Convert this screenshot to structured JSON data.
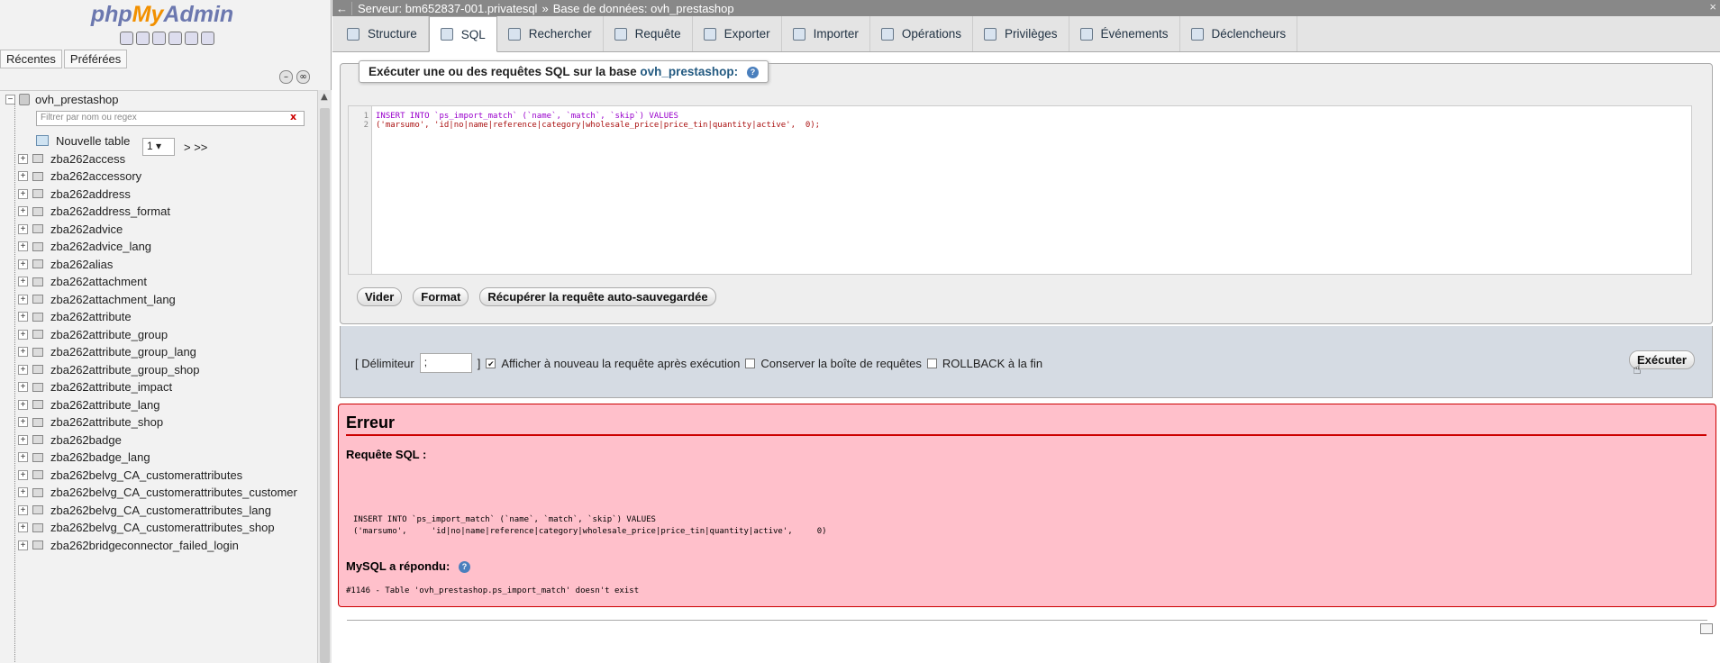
{
  "app": {
    "logo_php": "php",
    "logo_my": "My",
    "logo_admin": "Admin"
  },
  "nav": {
    "recent_tab": "Récentes",
    "favorites_tab": "Préférées",
    "database": "ovh_prestashop",
    "filter_placeholder": "Filtrer par nom ou regex",
    "filter_clear": "x",
    "page_select": "1",
    "page_next": "> >>",
    "new_table": "Nouvelle table",
    "tables": [
      "zba262access",
      "zba262accessory",
      "zba262address",
      "zba262address_format",
      "zba262advice",
      "zba262advice_lang",
      "zba262alias",
      "zba262attachment",
      "zba262attachment_lang",
      "zba262attribute",
      "zba262attribute_group",
      "zba262attribute_group_lang",
      "zba262attribute_group_shop",
      "zba262attribute_impact",
      "zba262attribute_lang",
      "zba262attribute_shop",
      "zba262badge",
      "zba262badge_lang",
      "zba262belvg_CA_customerattributes",
      "zba262belvg_CA_customerattributes_customer",
      "zba262belvg_CA_customerattributes_lang",
      "zba262belvg_CA_customerattributes_shop",
      "zba262bridgeconnector_failed_login"
    ]
  },
  "breadcrumb": {
    "back": "←",
    "server": "Serveur: bm652837-001.privatesql",
    "sep": "»",
    "database": "Base de données: ovh_prestashop",
    "close": "×"
  },
  "menu": {
    "tabs": [
      {
        "label": "Structure",
        "active": false
      },
      {
        "label": "SQL",
        "active": true
      },
      {
        "label": "Rechercher",
        "active": false
      },
      {
        "label": "Requête",
        "active": false
      },
      {
        "label": "Exporter",
        "active": false
      },
      {
        "label": "Importer",
        "active": false
      },
      {
        "label": "Opérations",
        "active": false
      },
      {
        "label": "Privilèges",
        "active": false
      },
      {
        "label": "Événements",
        "active": false
      },
      {
        "label": "Déclencheurs",
        "active": false
      }
    ]
  },
  "sql_panel": {
    "legend_text": "Exécuter une ou des requêtes SQL sur la base",
    "legend_db": "ovh_prestashop:",
    "help": "?",
    "line_numbers": [
      "1",
      "2"
    ],
    "query_line1": "INSERT INTO `ps_import_match` (`name`, `match`, `skip`) VALUES",
    "query_line2": "('marsumo', 'id|no|name|reference|category|wholesale_price|price_tin|quantity|active',  0);",
    "btn_clear": "Vider",
    "btn_format": "Format",
    "btn_restore": "Récupérer la requête auto-sauvegardée"
  },
  "options": {
    "delimiter_label": "[ Délimiteur",
    "delimiter_value": ";",
    "delimiter_close": "]",
    "show_again_label": "Afficher à nouveau la requête après exécution",
    "show_again_checked": true,
    "keep_box_label": "Conserver la boîte de requêtes",
    "keep_box_checked": false,
    "rollback_label": "ROLLBACK à la fin",
    "rollback_checked": false,
    "execute_button": "Exécuter"
  },
  "error": {
    "title": "Erreur",
    "sql_label": "Requête SQL :",
    "code_line1": "INSERT INTO `ps_import_match` (`name`, `match`, `skip`) VALUES",
    "code_line2": "('marsumo',     'id|no|name|reference|category|wholesale_price|price_tin|quantity|active',     0)",
    "mysql_label": "MySQL a répondu:",
    "message": "#1146 - Table 'ovh_prestashop.ps_import_match' doesn't exist"
  },
  "colors": {
    "error_bg": "#ffc0cb",
    "error_border": "#cc0000",
    "link": "#235a81",
    "logo_orange": "#f29000",
    "logo_blue": "#6c78af"
  }
}
